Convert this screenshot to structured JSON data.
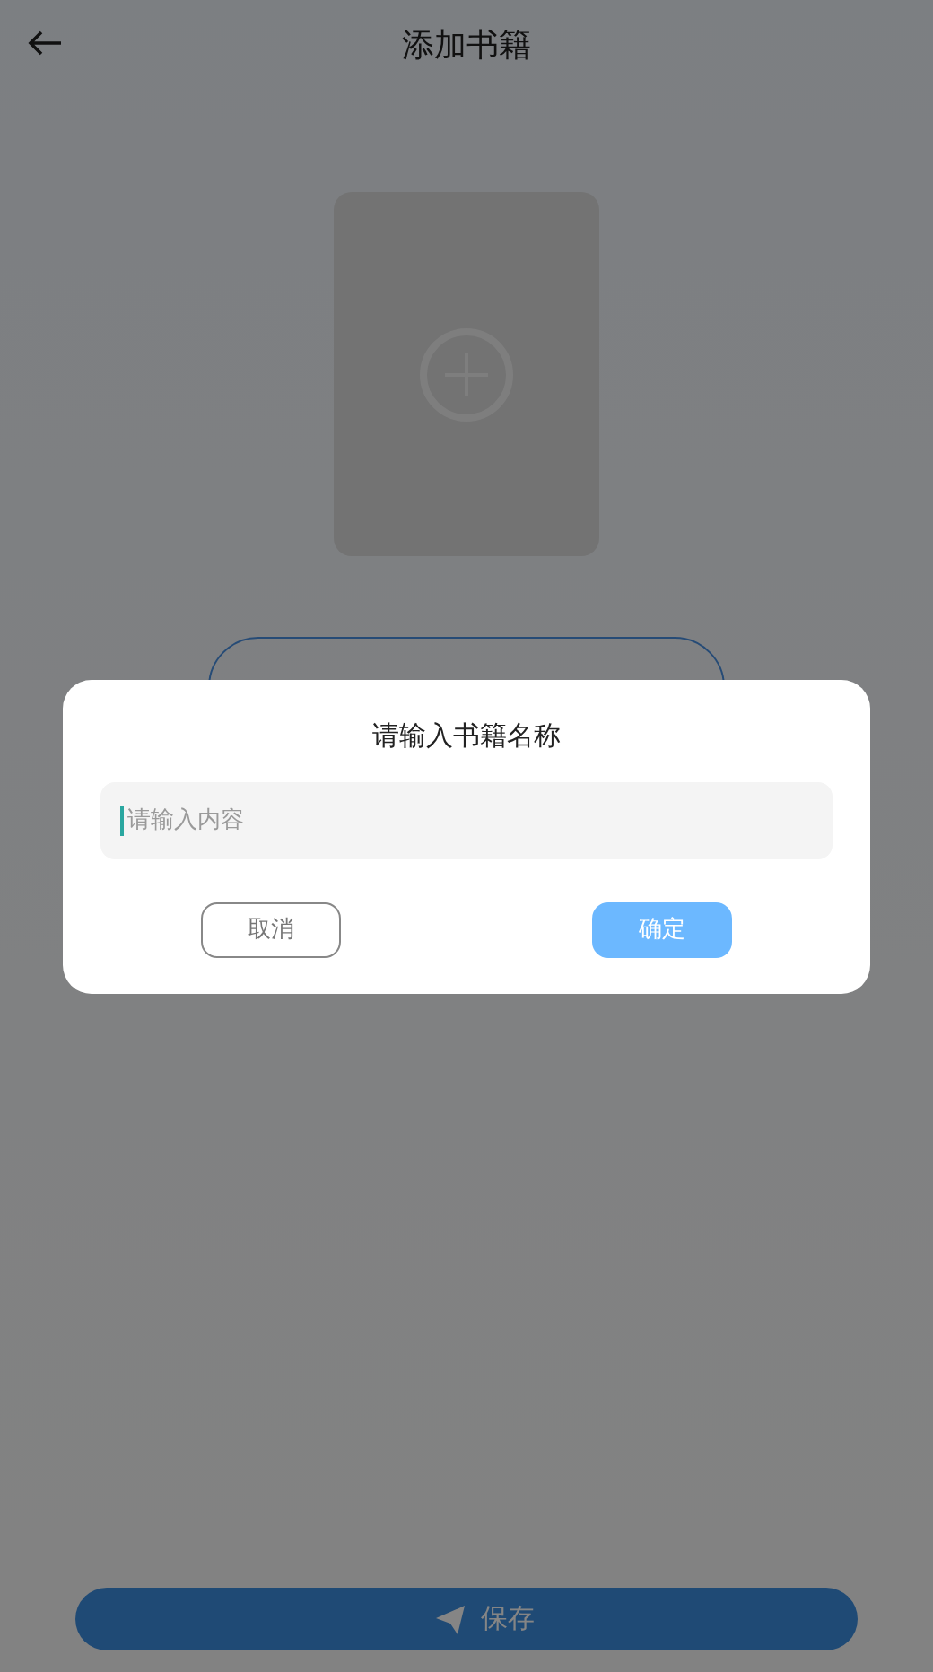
{
  "header": {
    "title": "添加书籍"
  },
  "save_button": {
    "label": "保存"
  },
  "dialog": {
    "title": "请输入书籍名称",
    "input": {
      "placeholder": "请输入内容",
      "focused": true
    },
    "buttons": [
      {
        "label": "取消",
        "kind": "outline"
      },
      {
        "label": "确定",
        "kind": "primary"
      }
    ]
  }
}
